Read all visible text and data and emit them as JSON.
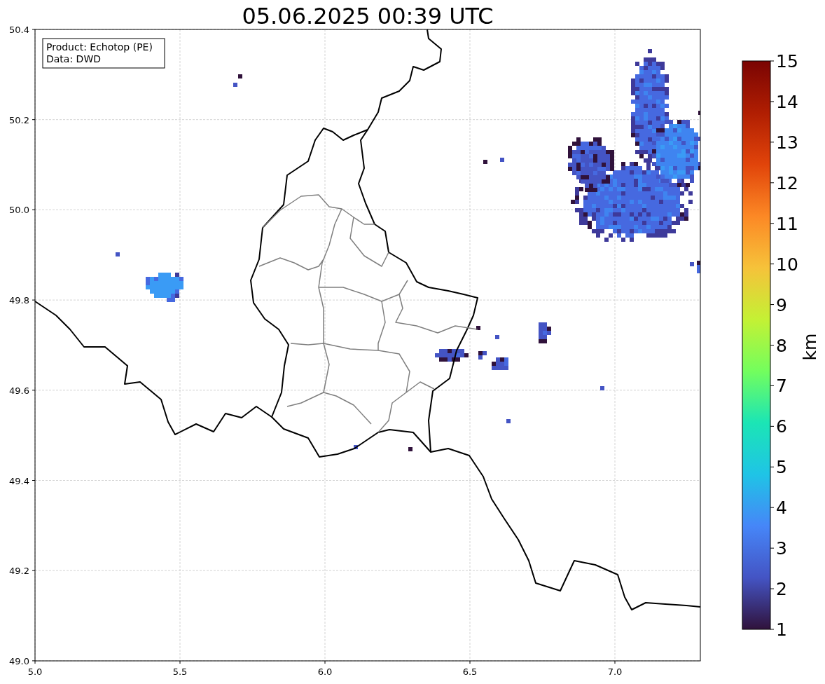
{
  "figure": {
    "title": "05.06.2025 00:39 UTC"
  },
  "info_box": {
    "lines": [
      "Product: Echotop (PE)",
      "Data: DWD"
    ]
  },
  "map": {
    "xticks": [
      "5.0",
      "5.5",
      "6.0",
      "6.5",
      "7.0"
    ],
    "yticks": [
      "50.4",
      "50.2",
      "50.0",
      "49.8",
      "49.6",
      "49.4",
      "49.2",
      "49.0"
    ]
  },
  "colorbar": {
    "label": "km",
    "ticks": [
      "15",
      "14",
      "13",
      "12",
      "11",
      "10",
      "9",
      "8",
      "7",
      "6",
      "5",
      "4",
      "3",
      "2",
      "1"
    ]
  }
}
